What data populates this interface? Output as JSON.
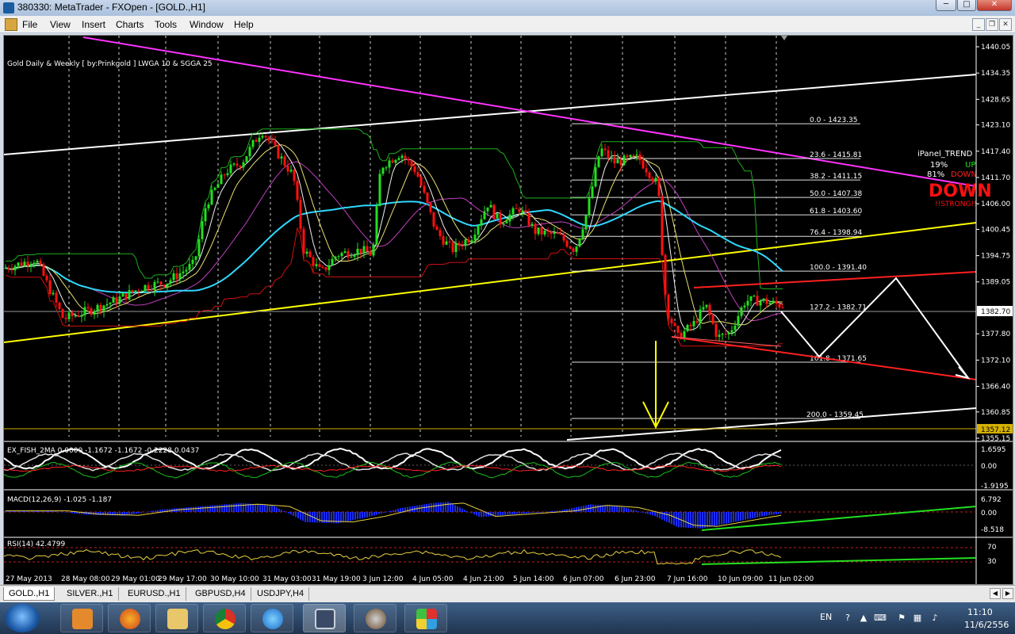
{
  "window": {
    "title": "380330: MetaTrader - FXOpen - [GOLD.,H1]",
    "controls": [
      "─",
      "□",
      "✕"
    ]
  },
  "menu": [
    "File",
    "View",
    "Insert",
    "Charts",
    "Tools",
    "Window",
    "Help"
  ],
  "mdi_controls": [
    "_",
    "❐",
    "✕"
  ],
  "chart": {
    "label": "Gold Daily & Weekly [ by:Prinkgold ] LWGA 10  &  SGGA 25",
    "price_ticks": [
      "1440.05",
      "1434.35",
      "1428.65",
      "1423.10",
      "1417.40",
      "1411.70",
      "1406.00",
      "1400.45",
      "1394.75",
      "1389.05",
      "1377.80",
      "1372.10",
      "1366.40",
      "1360.85",
      "1355.15"
    ],
    "current_price": "1382.70",
    "marked_price": "1357.12",
    "fib_levels": [
      "0.0 - 1423.35",
      "23.6 - 1415.81",
      "38.2 - 1411.15",
      "50.0 - 1407.38",
      "61.8 - 1403.60",
      "76.4 - 1398.94",
      "100.0 - 1391.40",
      "127.2 - 1382.71",
      "161.8 - 1371.65",
      "200.0 - 1359.45"
    ],
    "ipanel": {
      "title": "iPanel_TREND",
      "up_pct": "19%",
      "up_label": "UP",
      "down_pct": "81%",
      "down_label": "DOWN",
      "big_label": "DOWN",
      "strength": "!!STRONG!!"
    },
    "time_ticks": [
      "27 May 2013",
      "28 May 08:00",
      "29 May 01:00",
      "29 May 17:00",
      "30 May 10:00",
      "31 May 03:00",
      "31 May 19:00",
      "3 Jun 12:00",
      "4 Jun 05:00",
      "4 Jun 21:00",
      "5 Jun 14:00",
      "6 Jun 07:00",
      "6 Jun 23:00",
      "7 Jun 16:00",
      "10 Jun 09:00",
      "11 Jun 02:00"
    ],
    "colors": {
      "bull": "#22e01f",
      "bear": "#ff1111",
      "trendline": "#ffff00",
      "resistance": "#ff22ff",
      "ma_cyan": "#2fd8ff"
    }
  },
  "indicators": {
    "fish": {
      "label": "EX_FISH_2MA 0.0000 -1.1672 -1.1672 -0.2228 0.0437",
      "ticks": [
        "1.6595",
        "0.00",
        "-1.9195"
      ]
    },
    "macd": {
      "label": "MACD(12,26,9) -1.025 -1.187",
      "ticks": [
        "6.792",
        "0.00",
        "-8.518"
      ]
    },
    "rsi": {
      "label": "RSI(14) 42.4799",
      "ticks": [
        "70",
        "30"
      ]
    }
  },
  "tabs": [
    "GOLD.,H1",
    "SILVER.,H1",
    "EURUSD.,H1",
    "GBPUSD,H4",
    "USDJPY,H4"
  ],
  "taskbar": {
    "apps": [
      "media-player",
      "firefox",
      "explorer",
      "chrome",
      "internet-explorer",
      "metatrader",
      "trading-app",
      "paint"
    ],
    "lang": "EN",
    "time": "11:10",
    "date": "11/6/2556"
  }
}
